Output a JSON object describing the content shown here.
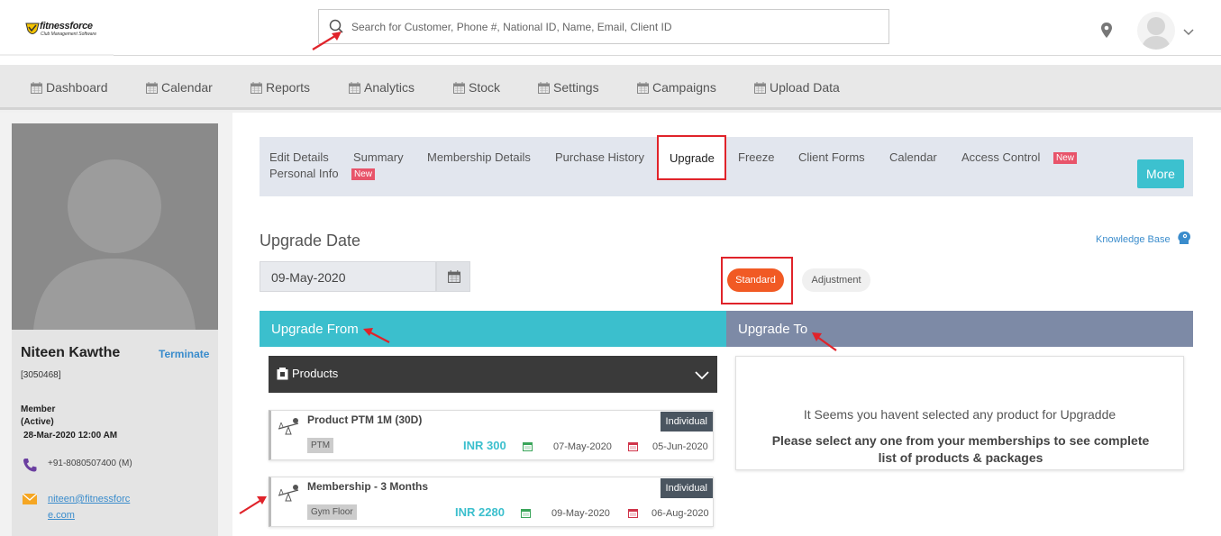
{
  "header": {
    "logo_brand": "fitnessforce",
    "logo_tagline": "Club Management Software",
    "search_placeholder": "Search for Customer, Phone #, National ID, Name, Email, Client ID"
  },
  "nav": [
    {
      "label": "Dashboard"
    },
    {
      "label": "Calendar"
    },
    {
      "label": "Reports"
    },
    {
      "label": "Analytics"
    },
    {
      "label": "Stock"
    },
    {
      "label": "Settings"
    },
    {
      "label": "Campaigns"
    },
    {
      "label": "Upload Data"
    }
  ],
  "client": {
    "name": "Niteen Kawthe",
    "terminate_label": "Terminate",
    "id": "[3050468]",
    "member_type": "Member",
    "status": "(Active)",
    "since": "28-Mar-2020 12:00 AM",
    "phone": "+91-8080507400 (M)",
    "email_line1": "niteen@fitnessforc",
    "email_line2": "e.com"
  },
  "tabs": {
    "edit_details": "Edit Details",
    "personal_info": "Personal Info",
    "summary": "Summary",
    "membership_details": "Membership Details",
    "purchase_history": "Purchase History",
    "upgrade": "Upgrade",
    "freeze": "Freeze",
    "client_forms": "Client Forms",
    "calendar": "Calendar",
    "access_control": "Access Control",
    "new_badge": "New",
    "more": "More"
  },
  "upgrade": {
    "title": "Upgrade Date",
    "knowledge_base": "Knowledge Base",
    "date_value": "09-May-2020",
    "standard_label": "Standard",
    "adjustment_label": "Adjustment",
    "from_title": "Upgrade From",
    "to_title": "Upgrade To",
    "products_label": "Products",
    "items": [
      {
        "name": "Product PTM 1M (30D)",
        "type": "Individual",
        "tag": "PTM",
        "price": "INR 300",
        "start": "07-May-2020",
        "end": "05-Jun-2020"
      },
      {
        "name": "Membership - 3 Months",
        "type": "Individual",
        "tag": "Gym Floor",
        "price": "INR 2280",
        "start": "09-May-2020",
        "end": "06-Aug-2020"
      }
    ],
    "empty_line1": "It Seems you havent selected any product for Upgradde",
    "empty_line2": "Please select any one from your    memberships to see complete list of products & packages"
  },
  "colors": {
    "accent_teal": "#3bbfcd",
    "upgrade_to_header": "#7d8aa6",
    "standard_orange": "#f15a24",
    "highlight_red": "#e0232a",
    "link_blue": "#3a8ccc"
  }
}
